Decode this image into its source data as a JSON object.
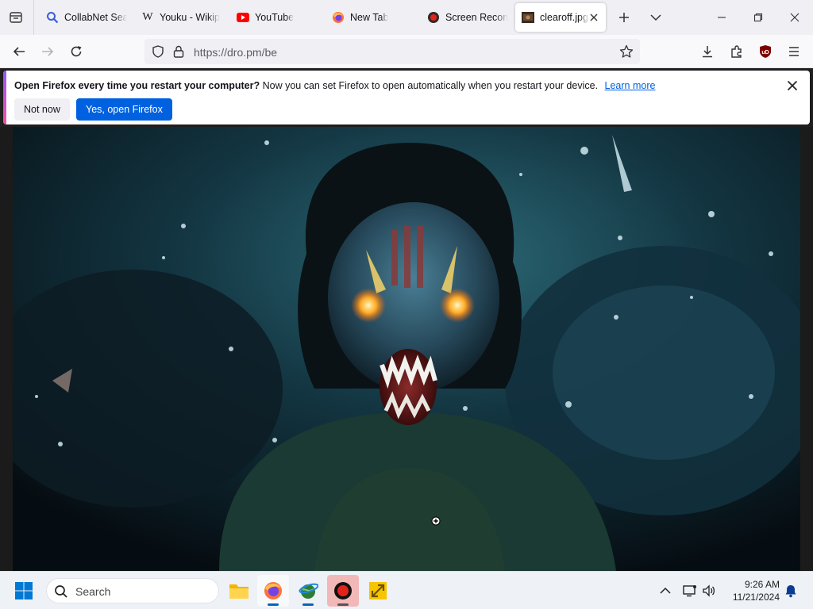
{
  "tabs": [
    {
      "label": "CollabNet Sea",
      "icon": "search-favicon",
      "active": false
    },
    {
      "label": "Youku - Wikip",
      "icon": "wikipedia-favicon",
      "active": false
    },
    {
      "label": "YouTube",
      "icon": "youtube-favicon",
      "active": false
    },
    {
      "label": "New Tab",
      "icon": "firefox-favicon",
      "active": false
    },
    {
      "label": "Screen Record",
      "icon": "record-favicon",
      "active": false
    },
    {
      "label": "clearoff.jpg",
      "icon": "image-thumbnail-favicon",
      "active": true
    }
  ],
  "wikipedia_glyph": "W",
  "address": {
    "url": "https://dro.pm/be"
  },
  "notification": {
    "title": "Open Firefox every time you restart your computer?",
    "body": "Now you can set Firefox to open automatically when you restart your device.",
    "link": "Learn more",
    "secondary_button": "Not now",
    "primary_button": "Yes, open Firefox"
  },
  "extension_badge": "uD",
  "taskbar": {
    "search_placeholder": "Search",
    "apps": [
      "file-explorer",
      "firefox",
      "internet-explorer-globe",
      "screen-recorder",
      "network-tool"
    ]
  },
  "clock": {
    "time": "9:26 AM",
    "date": "11/21/2024"
  },
  "colors": {
    "accent": "#0061e0",
    "tab_strip": "#f0f0f4",
    "youtube": "#ff0000",
    "ublock": "#800000"
  }
}
